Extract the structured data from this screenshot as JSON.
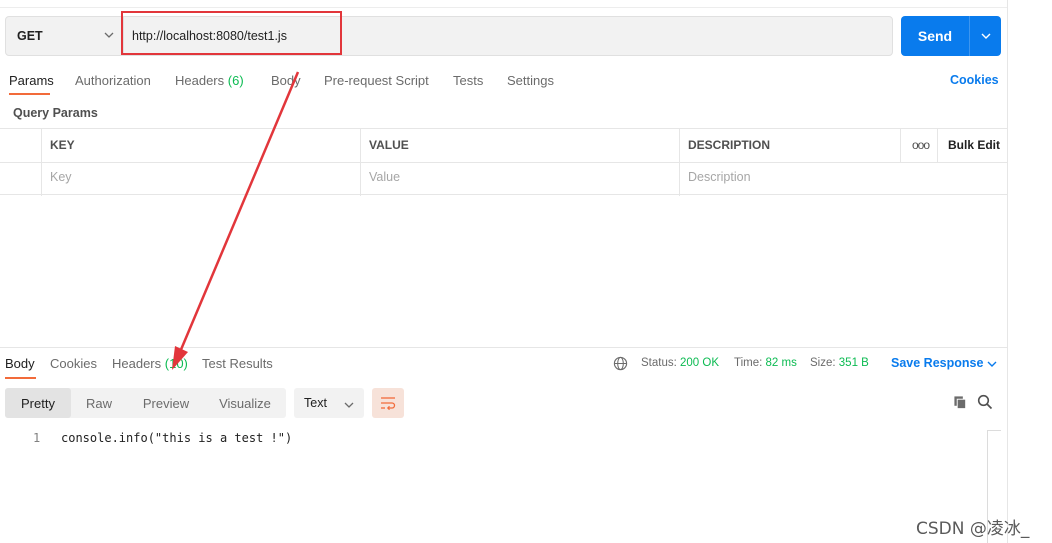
{
  "request": {
    "method": "GET",
    "url": "http://localhost:8080/test1.js",
    "send_label": "Send"
  },
  "request_tabs": [
    {
      "label": "Params"
    },
    {
      "label": "Authorization"
    },
    {
      "label": "Headers",
      "count": "(6)"
    },
    {
      "label": "Body"
    },
    {
      "label": "Pre-request Script"
    },
    {
      "label": "Tests"
    },
    {
      "label": "Settings"
    }
  ],
  "cookies_link": "Cookies",
  "query_params_title": "Query Params",
  "params_table": {
    "columns": [
      "KEY",
      "VALUE",
      "DESCRIPTION"
    ],
    "placeholders": [
      "Key",
      "Value",
      "Description"
    ],
    "more_label": "ooo",
    "bulk_edit": "Bulk Edit"
  },
  "response_tabs": [
    {
      "label": "Body"
    },
    {
      "label": "Cookies"
    },
    {
      "label": "Headers",
      "count": "(10)"
    },
    {
      "label": "Test Results"
    }
  ],
  "response_status": {
    "status_label": "Status:",
    "status_value": "200 OK",
    "time_label": "Time:",
    "time_value": "82 ms",
    "size_label": "Size:",
    "size_value": "351 B",
    "save_response": "Save Response"
  },
  "view_modes": [
    "Pretty",
    "Raw",
    "Preview",
    "Visualize"
  ],
  "format": "Text",
  "code_lines": [
    {
      "number": "1",
      "text": "console.info(\"this is a test !\")"
    }
  ],
  "watermark": "CSDN @凌冰_",
  "colors": {
    "accent": "#097bed",
    "active_tab": "#f26b3a",
    "success": "#0cbb52",
    "annotation": "#e2363b"
  },
  "icons": [
    "chevron-down-icon",
    "globe-icon",
    "wrap-lines-icon",
    "copy-icon",
    "search-icon"
  ]
}
